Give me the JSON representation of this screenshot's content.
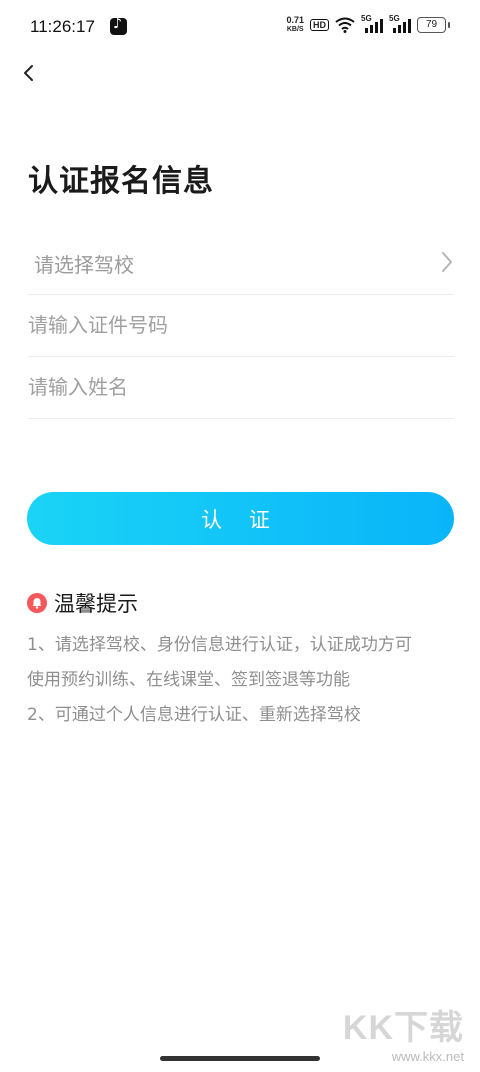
{
  "status_bar": {
    "time": "11:26:17",
    "net_speed_value": "0.71",
    "net_speed_unit": "KB/S",
    "hd_badge": "HD",
    "sim1_label": "5G",
    "sim2_label": "5G",
    "battery": "79",
    "app_icon": "tiktok-icon"
  },
  "header": {
    "back_icon": "chevron-left-icon"
  },
  "page": {
    "title": "认证报名信息"
  },
  "form": {
    "school_placeholder": "请选择驾校",
    "id_placeholder": "请输入证件号码",
    "name_placeholder": "请输入姓名",
    "submit_label": "认 证"
  },
  "tips": {
    "title": "温馨提示",
    "line1": "1、请选择驾校、身份信息进行认证，认证成功方可",
    "line2": "使用预约训练、在线课堂、签到签退等功能",
    "line3": "2、可通过个人信息进行认证、重新选择驾校"
  },
  "watermark": {
    "brand": "KK下载",
    "url": "www.kkx.net"
  },
  "colors": {
    "accent_start": "#1ad4f6",
    "accent_end": "#0ab4f9",
    "bell": "#f5575a"
  }
}
